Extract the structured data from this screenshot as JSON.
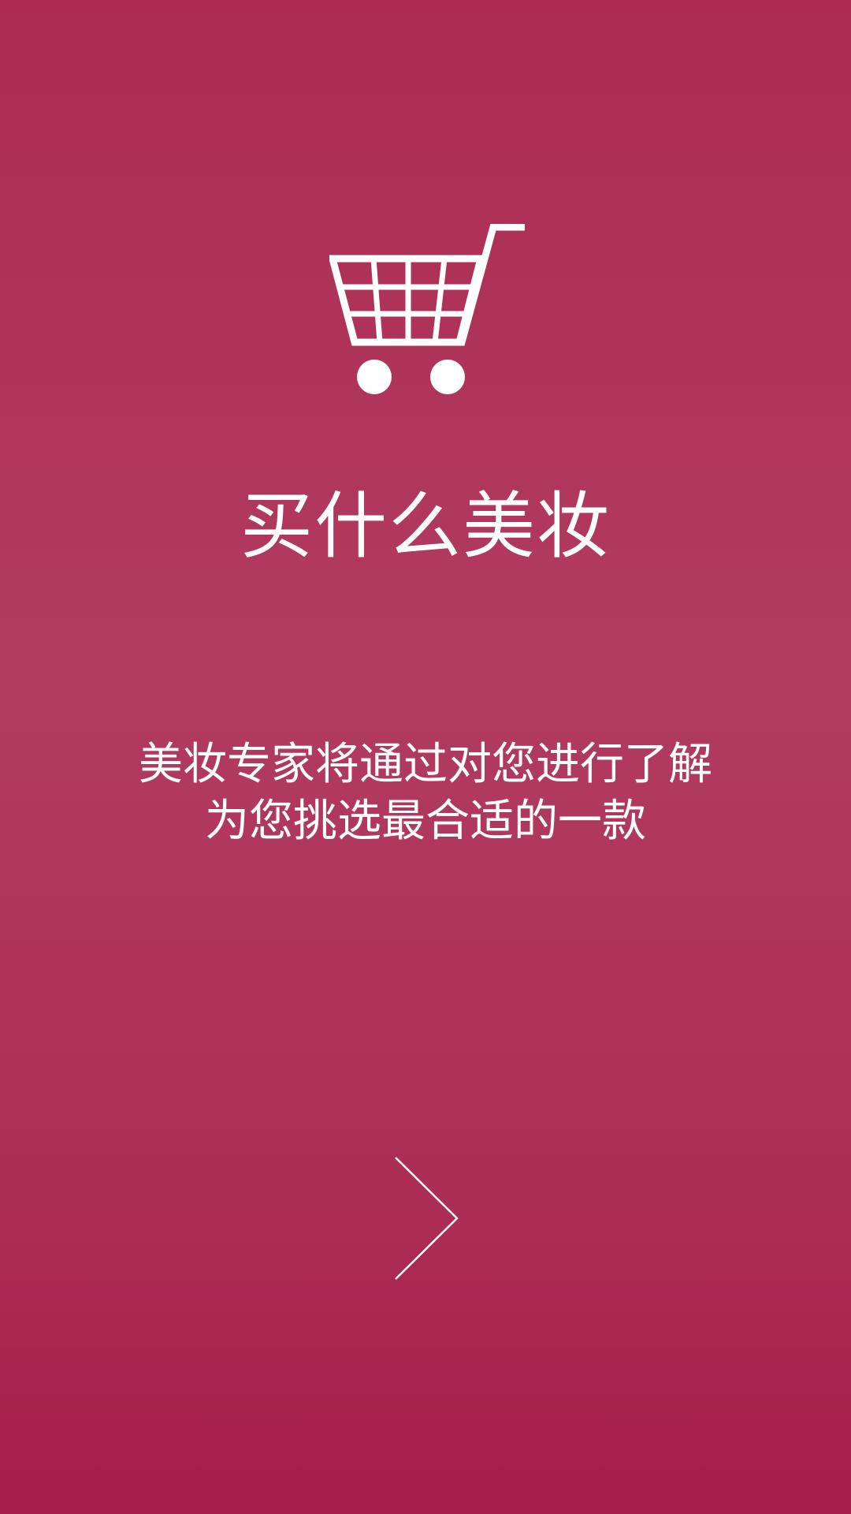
{
  "screen": {
    "title": "买什么美妆",
    "description_lines": [
      "美妆专家将通过对您进行了解",
      "为您挑选最合适的一款"
    ]
  },
  "icons": {
    "cart": "shopping-cart-icon",
    "next": "chevron-right-icon"
  },
  "colors": {
    "background_top": "#ad2b53",
    "background_mid": "#b13c5f",
    "background_bottom": "#a61c4a",
    "foreground": "#ffffff"
  }
}
